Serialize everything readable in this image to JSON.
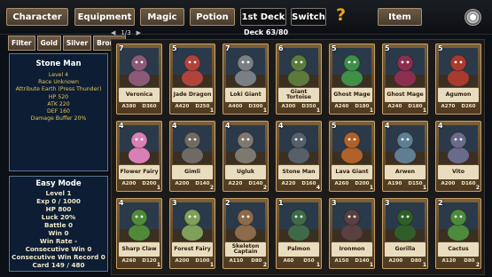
{
  "toolbar": {
    "character": "Character",
    "equipment": "Equipment",
    "magic": "Magic",
    "potion": "Potion",
    "deck1": "1st Deck",
    "switch": "Switch",
    "help": "?",
    "item": "Item"
  },
  "filters": [
    "Filter",
    "Gold",
    "Silver",
    "Bronze"
  ],
  "pager": {
    "page": "1/3",
    "deck_count": "Deck 63/80"
  },
  "info": {
    "name": "Stone Man",
    "lines": [
      "Level 4",
      "Race Unknown",
      "Attribute Earth (Press Thunder)",
      "HP 520",
      "ATK 220",
      "DEF 160",
      "Damage Buffer 20%"
    ]
  },
  "stats": {
    "mode": "Easy Mode",
    "lines": [
      "Level 1",
      "Exp 0 / 1000",
      "HP 800",
      "Luck 20%",
      "Battle 0",
      "Win 0",
      "Win Rate -",
      "Consecutive Win 0",
      "Consecutive Win Record 0",
      "Card 149 / 480"
    ]
  },
  "colors": {
    "gold": "#e6c45b",
    "accent": "#e8a41c",
    "panel": "#0d1d33"
  },
  "cards": [
    {
      "cost": "7",
      "name": "Veronica",
      "atk": "A380",
      "def": "D360",
      "count": "",
      "art": "#8a5a78"
    },
    {
      "cost": "5",
      "name": "Jade Dragon",
      "atk": "A420",
      "def": "D250",
      "count": "1",
      "art": "#b0433a"
    },
    {
      "cost": "7",
      "name": "Loki Giant",
      "atk": "A400",
      "def": "D300",
      "count": "1",
      "art": "#7a7f86"
    },
    {
      "cost": "6",
      "name": "Giant Tortoise",
      "atk": "A300",
      "def": "D350",
      "count": "1",
      "art": "#5c7a3c"
    },
    {
      "cost": "5",
      "name": "Ghost Mage",
      "atk": "A240",
      "def": "D180",
      "count": "1",
      "art": "#3f8f48"
    },
    {
      "cost": "5",
      "name": "Ghost Mage",
      "atk": "A240",
      "def": "D180",
      "count": "1",
      "art": "#8a2f4f"
    },
    {
      "cost": "5",
      "name": "Agumon",
      "atk": "A270",
      "def": "D260",
      "count": "",
      "art": "#a83a2e"
    },
    {
      "cost": "4",
      "name": "Flower Fairy",
      "atk": "A200",
      "def": "D200",
      "count": "1",
      "art": "#d97fb5"
    },
    {
      "cost": "4",
      "name": "Gimli",
      "atk": "A200",
      "def": "D140",
      "count": "2",
      "art": "#6f6a64"
    },
    {
      "cost": "4",
      "name": "Ugluk",
      "atk": "A220",
      "def": "D140",
      "count": "2",
      "art": "#7d7870"
    },
    {
      "cost": "4",
      "name": "Stone Man",
      "atk": "A220",
      "def": "D160",
      "count": "4",
      "art": "#55606b"
    },
    {
      "cost": "5",
      "name": "Lava Giant",
      "atk": "A260",
      "def": "D200",
      "count": "1",
      "art": "#b0612a"
    },
    {
      "cost": "4",
      "name": "Arwen",
      "atk": "A190",
      "def": "D150",
      "count": "1",
      "art": "#5f7e92"
    },
    {
      "cost": "4",
      "name": "Vito",
      "atk": "A200",
      "def": "D160",
      "count": "2",
      "art": "#6a6a8a"
    },
    {
      "cost": "4",
      "name": "Sharp Claw",
      "atk": "A260",
      "def": "D120",
      "count": "1",
      "art": "#4f8a3a"
    },
    {
      "cost": "3",
      "name": "Forest Fairy",
      "atk": "A200",
      "def": "D100",
      "count": "1",
      "art": "#7fa05a"
    },
    {
      "cost": "2",
      "name": "Skeleton Captain",
      "atk": "A110",
      "def": "D80",
      "count": "2",
      "art": "#8c6a4a"
    },
    {
      "cost": "1",
      "name": "Palmon",
      "atk": "A60",
      "def": "D50",
      "count": "1",
      "art": "#3e6a4a"
    },
    {
      "cost": "3",
      "name": "Ironmon",
      "atk": "A150",
      "def": "D140",
      "count": "1",
      "art": "#5a4040"
    },
    {
      "cost": "3",
      "name": "Gorilla",
      "atk": "A200",
      "def": "D80",
      "count": "1",
      "art": "#2f5e2a"
    },
    {
      "cost": "2",
      "name": "Cactus",
      "atk": "A120",
      "def": "D80",
      "count": "2",
      "art": "#4d8a3c"
    }
  ]
}
